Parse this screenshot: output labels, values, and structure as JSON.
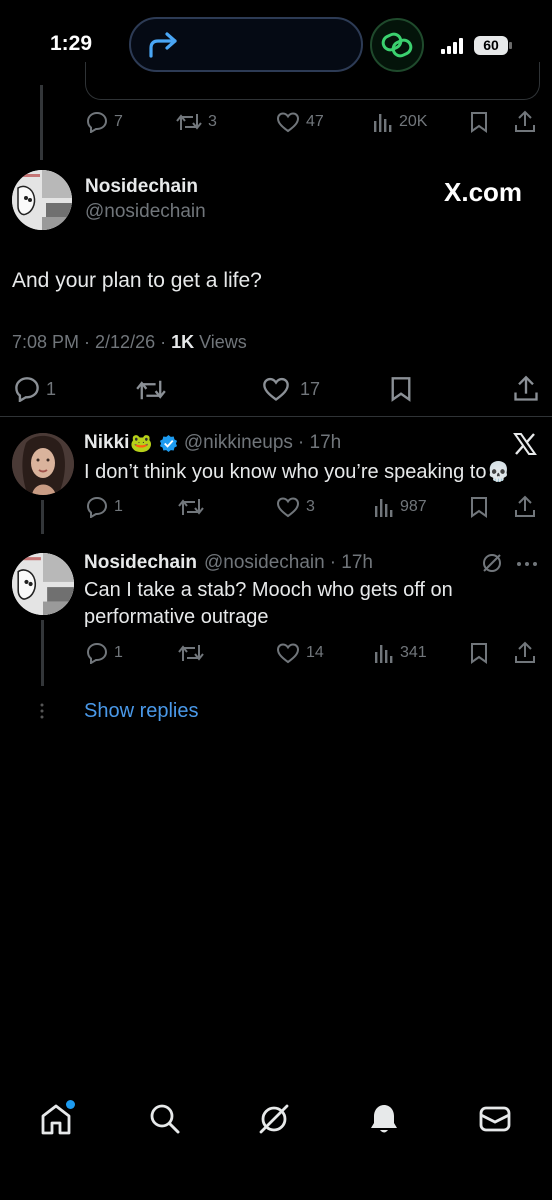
{
  "status_bar": {
    "time": "1:29",
    "battery": "60"
  },
  "quoted_actions": {
    "replies": "7",
    "reposts": "3",
    "likes": "47",
    "views": "20K"
  },
  "main_post": {
    "name": "Nosidechain",
    "handle": "@nosidechain",
    "brand": "X.com",
    "text": "And your plan to get a life?",
    "time_date": "7:08 PM · 2/12/26 · ",
    "views_count": "1K",
    "views_label": " Views",
    "replies": "1",
    "likes": "17"
  },
  "replies": [
    {
      "name": "Nikki",
      "emoji": "🐸",
      "handle": "@nikkineups",
      "age": "· 17h",
      "text": "I don’t think you know who you’re speaking to",
      "text_emoji": "💀",
      "replies": "1",
      "reposts": "",
      "likes": "3",
      "views": "987"
    },
    {
      "name": "Nosidechain",
      "handle": "@nosidechain",
      "age": "· 17h",
      "text": "Can I take a stab? Mooch who gets off on performative outrage",
      "replies": "1",
      "likes": "14",
      "views": "341"
    }
  ],
  "show_replies": "Show replies",
  "colors": {
    "background": "#000000",
    "text": "#e7e9ea",
    "muted": "#71767b",
    "link": "#4a99e9",
    "verified": "#1d9bf0",
    "divider": "#2f3336"
  },
  "icons": [
    "share-arrow-icon",
    "link-icon",
    "signal-icon",
    "battery-icon",
    "reply-icon",
    "repost-icon",
    "like-icon",
    "views-icon",
    "bookmark-icon",
    "share-icon",
    "verified-icon",
    "x-logo-icon",
    "grok-icon",
    "more-icon",
    "home-icon",
    "search-icon",
    "notifications-icon",
    "messages-icon"
  ]
}
